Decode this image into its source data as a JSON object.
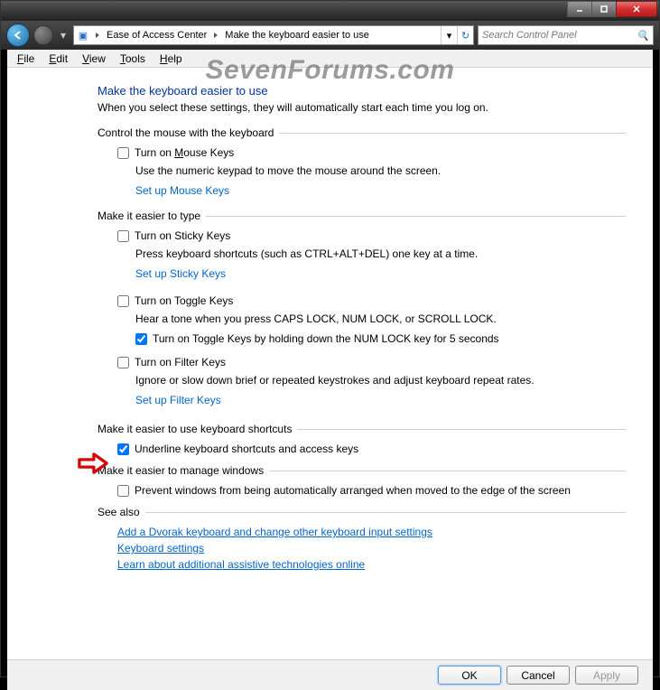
{
  "watermark": "SevenForums.com",
  "breadcrumb": {
    "seg1": "Ease of Access Center",
    "seg2": "Make the keyboard easier to use"
  },
  "search": {
    "placeholder": "Search Control Panel"
  },
  "menu": {
    "file": "File",
    "edit": "Edit",
    "view": "View",
    "tools": "Tools",
    "help": "Help"
  },
  "page": {
    "title": "Make the keyboard easier to use",
    "subtitle": "When you select these settings, they will automatically start each time you log on."
  },
  "sections": {
    "mouse": {
      "heading": "Control the mouse with the keyboard",
      "mousekeys_label": "Turn on Mouse Keys",
      "mousekeys_desc": "Use the numeric keypad to move the mouse around the screen.",
      "mousekeys_link": "Set up Mouse Keys"
    },
    "type": {
      "heading": "Make it easier to type",
      "sticky_label": "Turn on Sticky Keys",
      "sticky_desc": "Press keyboard shortcuts (such as CTRL+ALT+DEL) one key at a time.",
      "sticky_link": "Set up Sticky Keys",
      "toggle_label": "Turn on Toggle Keys",
      "toggle_desc": "Hear a tone when you press CAPS LOCK, NUM LOCK, or SCROLL LOCK.",
      "toggle_sub_pre": "Turn on Toggle Keys by holding down the NUM LOCK key for ",
      "toggle_sub_u": "5",
      "toggle_sub_post": " seconds",
      "filter_label": "Turn on Filter Keys",
      "filter_desc": "Ignore or slow down brief or repeated keystrokes and adjust keyboard repeat rates.",
      "filter_link": "Set up Filter Keys"
    },
    "shortcuts": {
      "heading": "Make it easier to use keyboard shortcuts",
      "underline_pre": "U",
      "underline_post": "nderline keyboard shortcuts and access keys"
    },
    "windows": {
      "heading": "Make it easier to manage windows",
      "prevent_label": "Prevent windows from being automatically arranged when moved to the edge of the screen"
    },
    "seealso": {
      "heading": "See also",
      "link1": "Add a Dvorak keyboard and change other keyboard input settings",
      "link2": "Keyboard settings",
      "link3": "Learn about additional assistive technologies online"
    }
  },
  "buttons": {
    "ok_u": "O",
    "ok_post": "K",
    "cancel": "Cancel",
    "apply_u": "A",
    "apply_post": "pply"
  }
}
